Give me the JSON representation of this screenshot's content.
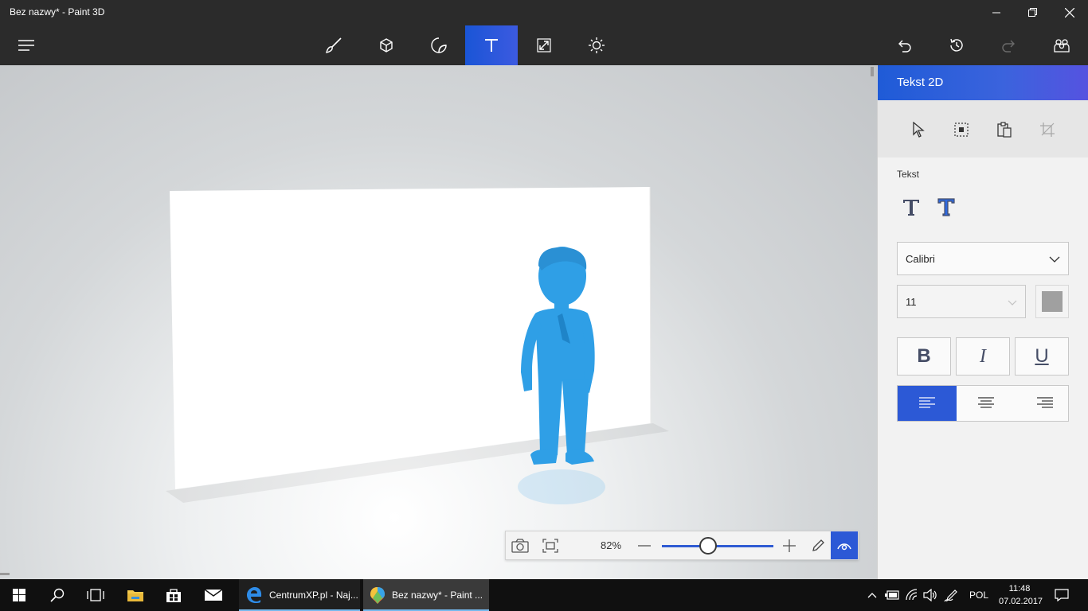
{
  "window": {
    "title": "Bez nazwy* - Paint 3D"
  },
  "toolbar": {
    "tools": [
      "brushes-icon",
      "3d-objects-icon",
      "stickers-icon",
      "text-icon",
      "canvas-icon",
      "effects-icon"
    ],
    "active_tool": "text-icon",
    "right_tools": [
      "undo-icon",
      "history-icon",
      "redo-icon",
      "remix-community-icon"
    ]
  },
  "zoom": {
    "value_label": "82%",
    "level_percent": 82
  },
  "panel": {
    "title": "Tekst 2D",
    "section_label": "Tekst",
    "font": "Calibri",
    "size": "11",
    "color": "#a0a0a0",
    "bold_label": "B",
    "italic_label": "I",
    "underline_label": "U",
    "active_align": "left"
  },
  "taskbar": {
    "apps": [
      {
        "label": "CentrumXP.pl - Naj..."
      },
      {
        "label": "Bez nazwy* - Paint ..."
      }
    ],
    "language": "POL",
    "time": "11:48",
    "date": "07.02.2017"
  },
  "colors": {
    "accent": "#2c59d6",
    "figure": "#2f9fe6",
    "taskbar": "#101010",
    "titlebar": "#2b2b2b"
  }
}
